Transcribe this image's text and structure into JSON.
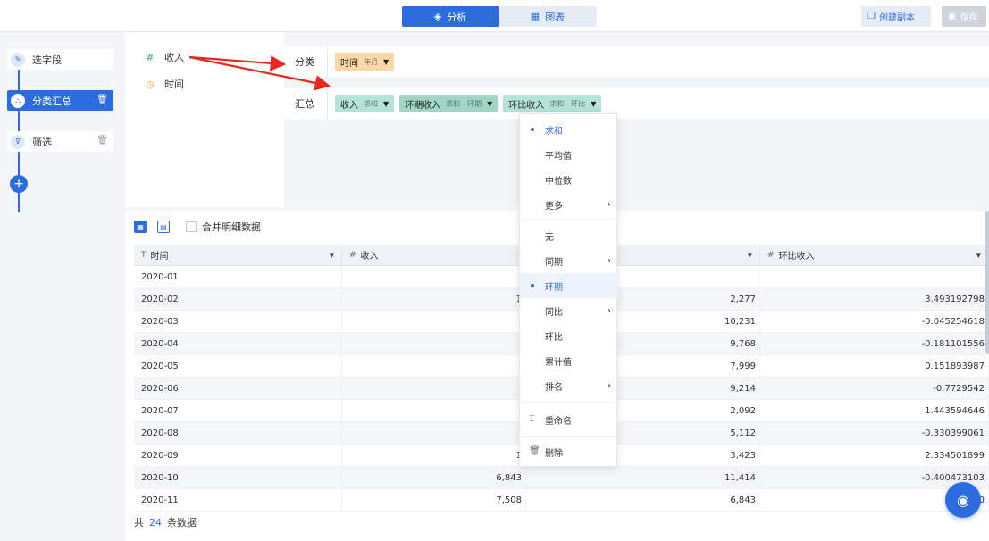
{
  "toolbar": {
    "tabs": [
      {
        "label": "分析",
        "icon": "layers-icon",
        "active": true
      },
      {
        "label": "图表",
        "icon": "chart-icon",
        "active": false
      }
    ],
    "create_copy_label": "创建副本",
    "save_label": "保存"
  },
  "steps": [
    {
      "label": "选字段",
      "icon": "fields-icon"
    },
    {
      "label": "分类汇总",
      "icon": "group-icon",
      "active": true
    },
    {
      "label": "筛选",
      "icon": "filter-icon"
    }
  ],
  "fields": [
    {
      "type_symbol": "#",
      "name": "收入"
    },
    {
      "type_symbol": "◷",
      "name": "时间"
    }
  ],
  "config": {
    "category_label": "分类",
    "category_tags": [
      {
        "name": "时间",
        "sub": "年月"
      }
    ],
    "summary_label": "汇总",
    "summary_tags": [
      {
        "name": "收入",
        "sub": "求和"
      },
      {
        "name": "环期收入",
        "sub": "求和 - 环期"
      },
      {
        "name": "环比收入",
        "sub": "求和 - 环比"
      }
    ]
  },
  "table_toolbar": {
    "merge_label": "合并明细数据"
  },
  "table": {
    "headers": [
      {
        "type": "T",
        "label": "时间"
      },
      {
        "type": "#",
        "label": "收入"
      },
      {
        "type": "",
        "label": ""
      },
      {
        "type": "#",
        "label": "环比收入"
      }
    ],
    "rows": [
      [
        "2020-01",
        "",
        "",
        ""
      ],
      [
        "2020-02",
        "1",
        "2,277",
        "3.493192798"
      ],
      [
        "2020-03",
        "",
        "10,231",
        "-0.045254618"
      ],
      [
        "2020-04",
        "",
        "9,768",
        "-0.181101556"
      ],
      [
        "2020-05",
        "",
        "7,999",
        "0.151893987"
      ],
      [
        "2020-06",
        "",
        "9,214",
        "-0.7729542"
      ],
      [
        "2020-07",
        "",
        "2,092",
        "1.443594646"
      ],
      [
        "2020-08",
        "",
        "5,112",
        "-0.330399061"
      ],
      [
        "2020-09",
        "1",
        "3,423",
        "2.334501899"
      ],
      [
        "2020-10",
        "6,843",
        "11,414",
        "-0.400473103"
      ],
      [
        "2020-11",
        "7,508",
        "6,843",
        "0.0"
      ]
    ]
  },
  "footer": {
    "prefix": "共",
    "count": "24",
    "suffix": "条数据"
  },
  "menu": {
    "items": [
      {
        "label": "求和",
        "selected": true
      },
      {
        "label": "平均值"
      },
      {
        "label": "中位数"
      },
      {
        "label": "更多",
        "submenu": true
      },
      {
        "label": "无"
      },
      {
        "label": "同期",
        "submenu": true
      },
      {
        "label": "环期",
        "selected": true,
        "highlight": true
      },
      {
        "label": "同比",
        "submenu": true
      },
      {
        "label": "环比"
      },
      {
        "label": "累计值"
      },
      {
        "label": "排名",
        "submenu": true
      },
      {
        "label": "重命名",
        "icon": "rename-icon"
      },
      {
        "label": "删除",
        "icon": "trash-icon"
      }
    ]
  },
  "colors": {
    "accent": "#2d6cdf",
    "arrow": "#e8271f",
    "dimension_tag": "#f9d7a6",
    "measure_tag": "#b4e2d6"
  }
}
